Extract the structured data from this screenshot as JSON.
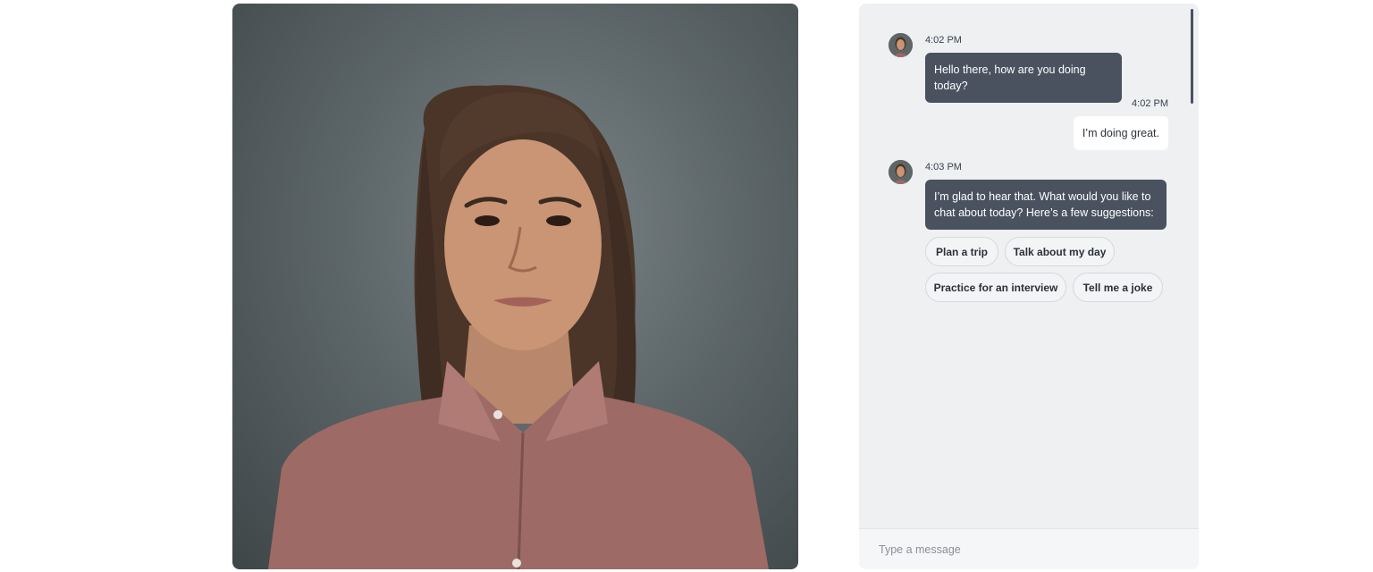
{
  "video": {
    "icon": "digital-human-avatar"
  },
  "chat": {
    "messages": [
      {
        "sender": "assistant",
        "time": "4:02 PM",
        "text": "Hello there, how are you doing today?"
      },
      {
        "sender": "user",
        "time": "4:02 PM",
        "text": "I’m doing great."
      },
      {
        "sender": "assistant",
        "time": "4:03 PM",
        "text": "I’m glad to hear that. What would you like to chat about today? Here’s a few suggestions:"
      }
    ],
    "suggestions": [
      "Plan a trip",
      "Talk about my day",
      "Practice for an interview",
      "Tell me a joke"
    ],
    "input": {
      "placeholder": "Type a message",
      "value": ""
    }
  },
  "colors": {
    "assistant_bubble": "#4a5260",
    "user_bubble": "#ffffff",
    "panel_background": "#eef0f2"
  }
}
